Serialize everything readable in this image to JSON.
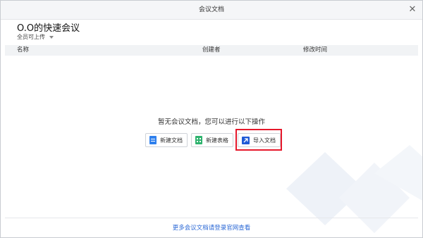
{
  "window": {
    "title": "会议文档",
    "close_label": "✕"
  },
  "meeting": {
    "title": "O.O的快速会议",
    "permission_label": "全员可上传"
  },
  "table": {
    "headers": [
      "名称",
      "创建者",
      "修改时间"
    ]
  },
  "empty_state": {
    "message": "暂无会议文档，您可以进行以下操作",
    "actions": [
      {
        "label": "新建文档",
        "icon": "doc-icon"
      },
      {
        "label": "新建表格",
        "icon": "sheet-icon"
      },
      {
        "label": "导入文档",
        "icon": "import-icon"
      }
    ]
  },
  "footer": {
    "link_text": "更多会议文档请登录官网查看"
  },
  "colors": {
    "accent": "#2d6ad6",
    "highlight": "#e6182b",
    "doc": "#2f80ed",
    "sheet": "#2fb36e",
    "import": "#1f5ad6"
  }
}
